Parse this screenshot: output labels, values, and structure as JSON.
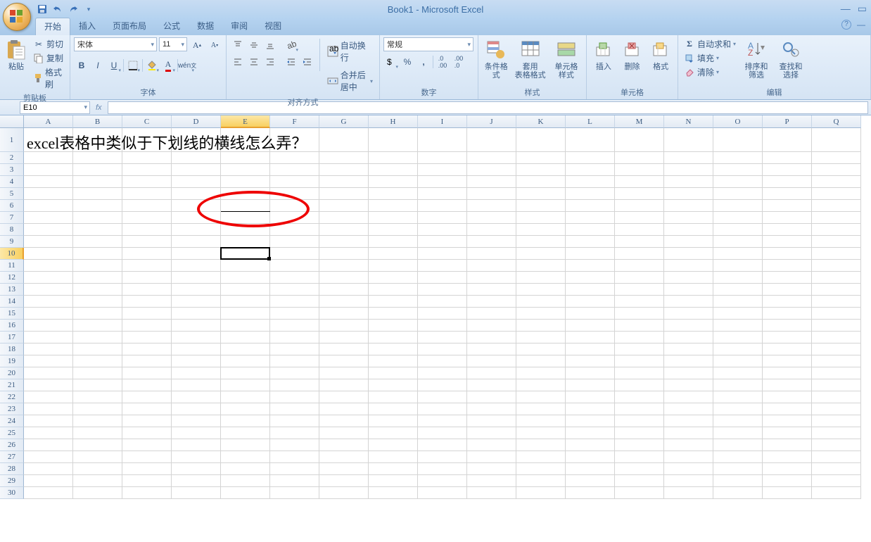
{
  "title": "Book1 - Microsoft Excel",
  "tabs": [
    "开始",
    "插入",
    "页面布局",
    "公式",
    "数据",
    "审阅",
    "视图"
  ],
  "active_tab": 0,
  "clipboard": {
    "label": "剪贴板",
    "paste": "粘贴",
    "cut": "剪切",
    "copy": "复制",
    "painter": "格式刷"
  },
  "font": {
    "label": "字体",
    "name": "宋体",
    "size": "11"
  },
  "align": {
    "label": "对齐方式",
    "wrap": "自动换行",
    "merge": "合并后居中"
  },
  "number": {
    "label": "数字",
    "format": "常规"
  },
  "styles": {
    "label": "样式",
    "cond": "条件格式",
    "table": "套用\n表格格式",
    "cell": "单元格\n样式"
  },
  "cells": {
    "label": "单元格",
    "insert": "插入",
    "delete": "删除",
    "format": "格式"
  },
  "editing": {
    "label": "编辑",
    "sum": "自动求和",
    "fill": "填充",
    "clear": "清除",
    "sort": "排序和\n筛选",
    "find": "查找和\n选择"
  },
  "namebox": "E10",
  "cell_a1": "excel表格中类似于下划线的横线怎么弄？",
  "columns": [
    "A",
    "B",
    "C",
    "D",
    "E",
    "F",
    "G",
    "H",
    "I",
    "J",
    "K",
    "L",
    "M",
    "N",
    "O",
    "P",
    "Q"
  ],
  "row_count": 30,
  "selected_col_index": 4,
  "selected_row": 10
}
